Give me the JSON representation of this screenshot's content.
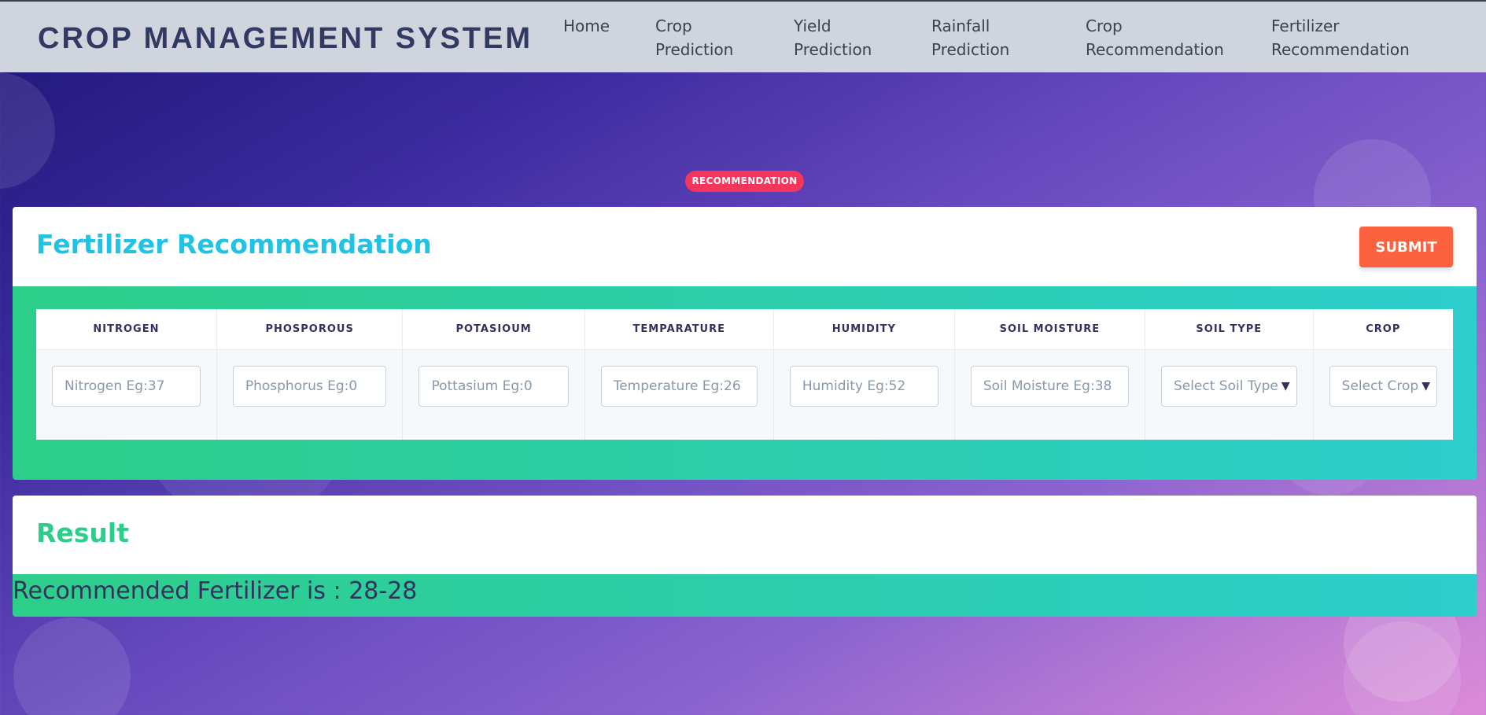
{
  "header": {
    "brand": "CROP MANAGEMENT SYSTEM",
    "nav": [
      {
        "line1": "Home",
        "line2": ""
      },
      {
        "line1": "Crop",
        "line2": "Prediction"
      },
      {
        "line1": "Yield",
        "line2": "Prediction"
      },
      {
        "line1": "Rainfall",
        "line2": "Prediction"
      },
      {
        "line1": "Crop",
        "line2": "Recommendation"
      },
      {
        "line1": "Fertilizer",
        "line2": "Recommendation"
      }
    ]
  },
  "badge": "RECOMMENDATION",
  "form": {
    "title": "Fertilizer Recommendation",
    "submit_label": "SUBMIT",
    "columns": [
      "NITROGEN",
      "PHOSPOROUS",
      "POTASIOUM",
      "TEMPARATURE",
      "HUMIDITY",
      "SOIL MOISTURE",
      "SOIL TYPE",
      "CROP"
    ],
    "fields": [
      {
        "placeholder": "Nitrogen Eg:37"
      },
      {
        "placeholder": "Phosphorus Eg:0"
      },
      {
        "placeholder": "Pottasium Eg:0"
      },
      {
        "placeholder": "Temperature Eg:26"
      },
      {
        "placeholder": "Humidity Eg:52"
      },
      {
        "placeholder": "Soil Moisture Eg:38"
      },
      {
        "selected": "Select Soil Type"
      },
      {
        "selected": "Select Crop"
      }
    ]
  },
  "result": {
    "title": "Result",
    "text": "Recommended Fertilizer is : 28-28"
  },
  "colors": {
    "accent_cyan": "#1ec3e6",
    "accent_green": "#2dce89",
    "submit": "#fb6340",
    "badge": "#f5365c"
  }
}
